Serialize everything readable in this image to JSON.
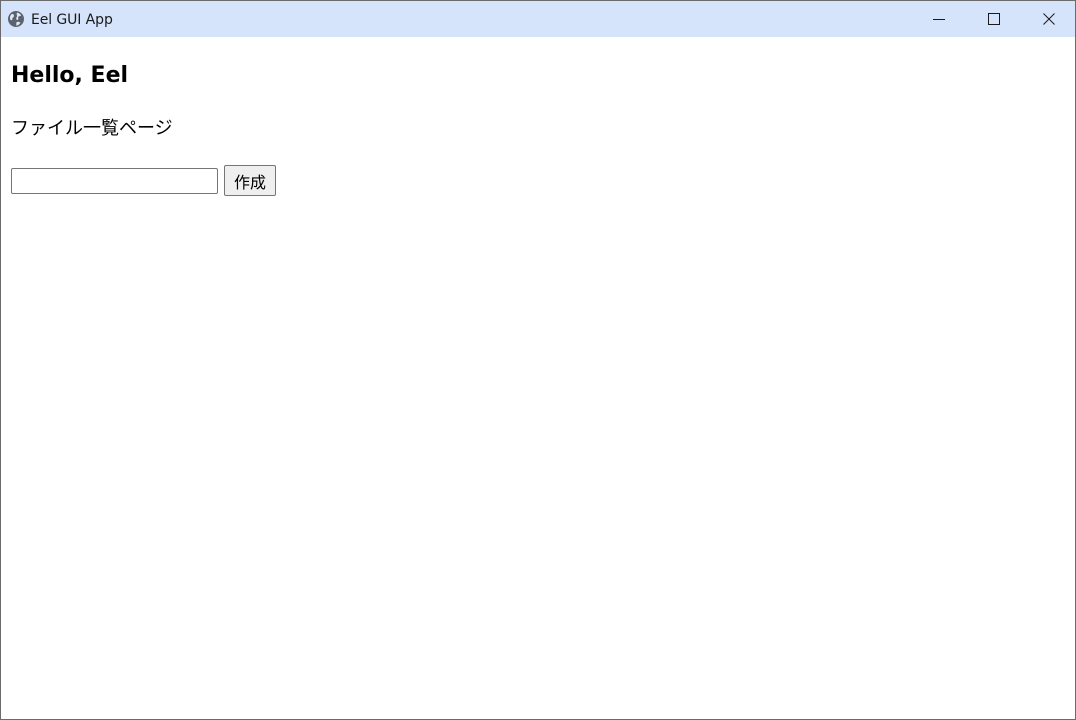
{
  "window": {
    "title": "Eel GUI App",
    "app_icon": "globe-icon",
    "controls": [
      "minimize-icon",
      "maximize-icon",
      "close-icon"
    ]
  },
  "page": {
    "heading": "Hello, Eel",
    "subtitle": "ファイル一覧ページ",
    "input": {
      "value": "",
      "placeholder": ""
    },
    "create_button_label": "作成"
  },
  "colors": {
    "titlebar_background": "#d5e3fb",
    "content_background": "#ffffff",
    "button_background": "#efefef"
  }
}
